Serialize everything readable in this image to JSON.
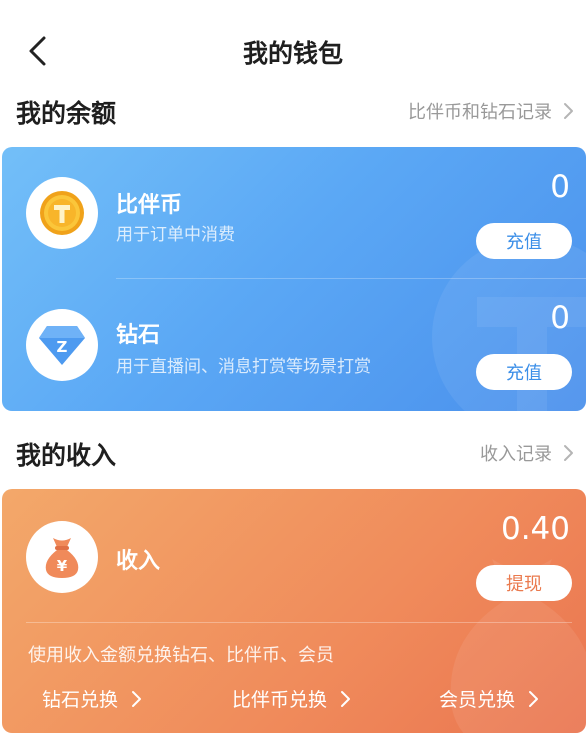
{
  "header": {
    "title": "我的钱包"
  },
  "balance": {
    "section_title": "我的余额",
    "records_link": "比伴币和钻石记录",
    "coin": {
      "name": "比伴币",
      "desc": "用于订单中消费",
      "amount": "0",
      "action": "充值"
    },
    "diamond": {
      "name": "钻石",
      "desc": "用于直播间、消息打赏等场景打赏",
      "amount": "0",
      "action": "充值",
      "icon_letter": "Z"
    }
  },
  "income": {
    "section_title": "我的收入",
    "records_link": "收入记录",
    "label": "收入",
    "amount": "0.40",
    "action": "提现",
    "exchange_note": "使用收入金额兑换钻石、比伴币、会员",
    "exchange_links": [
      "钻石兑换",
      "比伴币兑换",
      "会员兑换"
    ]
  },
  "colors": {
    "blue_card": "#5ba8f5",
    "orange_card": "#f08b5b",
    "coin_gold": "#f6b425",
    "diamond_blue": "#4d9af0"
  },
  "icons": {
    "back": "chevron-left-icon",
    "link": "chevron-right-icon",
    "coin": "coin-icon",
    "diamond": "diamond-icon",
    "income": "money-bag-icon"
  }
}
